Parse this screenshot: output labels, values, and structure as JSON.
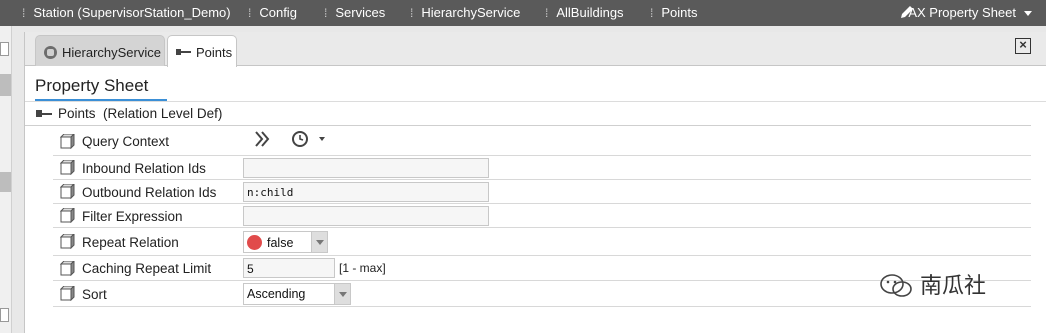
{
  "breadcrumbs": [
    {
      "label": "Station (SupervisorStation_Demo)"
    },
    {
      "label": "Config"
    },
    {
      "label": "Services"
    },
    {
      "label": "HierarchyService"
    },
    {
      "label": "AllBuildings"
    },
    {
      "label": "Points"
    }
  ],
  "view_selector": {
    "label": "AX Property Sheet"
  },
  "tabs": [
    {
      "label": "HierarchyService",
      "icon": "hierarchy-service-icon",
      "active": false
    },
    {
      "label": "Points",
      "icon": "relation-link-icon",
      "active": true
    }
  ],
  "sheet": {
    "title": "Property Sheet",
    "section_label": "Points",
    "section_type": "(Relation Level Def)",
    "rows": [
      {
        "label": "Query Context"
      },
      {
        "label": "Inbound Relation Ids",
        "value": ""
      },
      {
        "label": "Outbound Relation Ids",
        "value": "n:child"
      },
      {
        "label": "Filter Expression",
        "value": ""
      },
      {
        "label": "Repeat Relation",
        "value": "false"
      },
      {
        "label": "Caching Repeat Limit",
        "value": "5",
        "hint": "[1 - max]"
      },
      {
        "label": "Sort",
        "value": "Ascending"
      }
    ]
  },
  "watermark": {
    "text": "南瓜社"
  },
  "colors": {
    "topbar": "#5a5a5a",
    "accent": "#3b8fd6",
    "false_indicator": "#e14b4b"
  }
}
